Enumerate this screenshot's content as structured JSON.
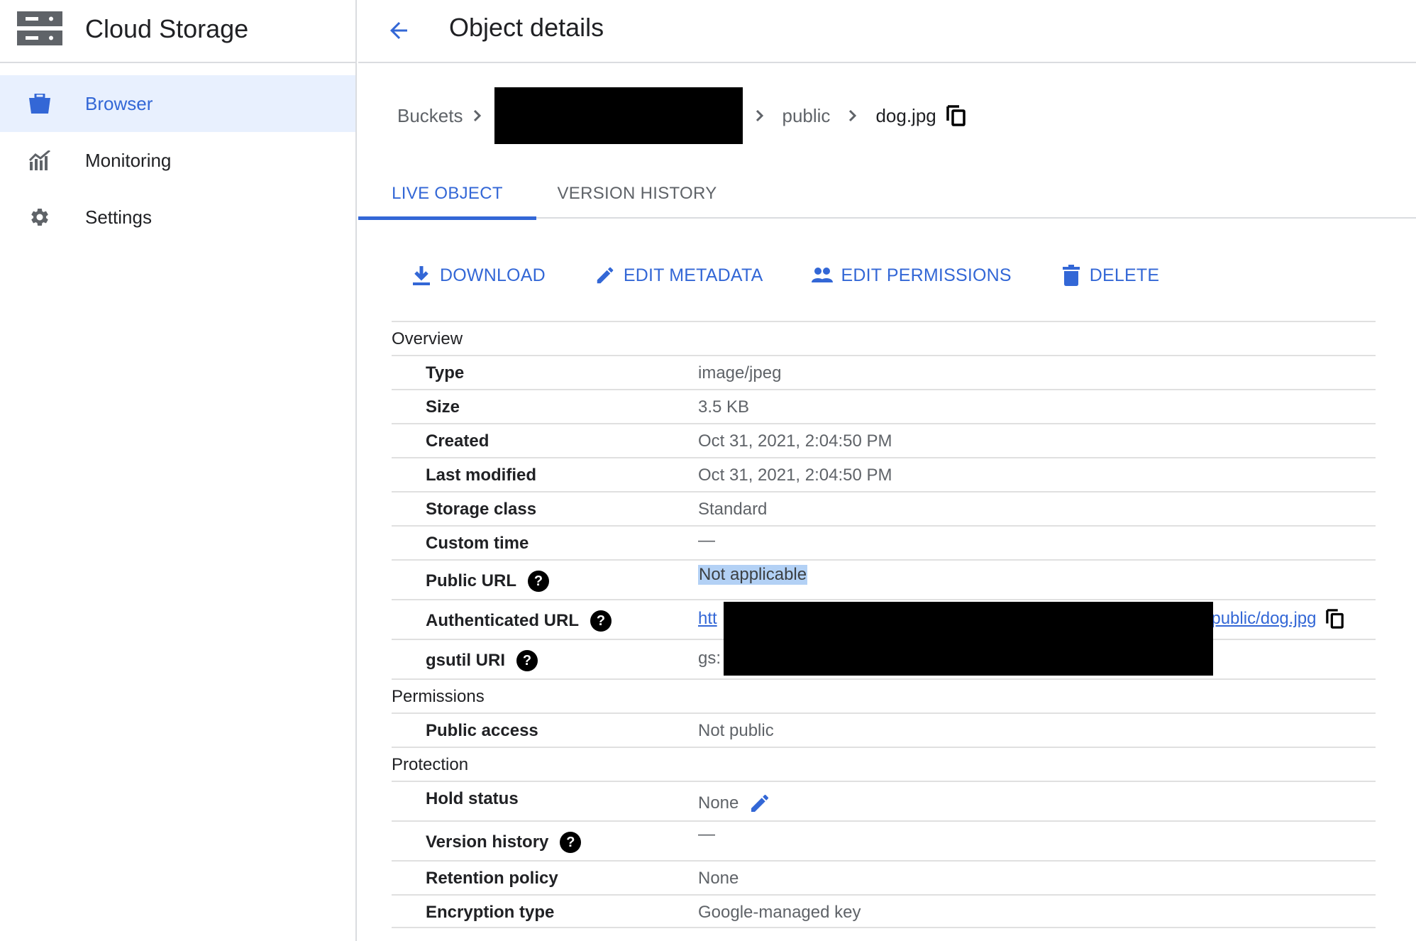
{
  "sidebar": {
    "title": "Cloud Storage",
    "items": [
      {
        "label": "Browser",
        "icon": "bucket-icon",
        "active": true
      },
      {
        "label": "Monitoring",
        "icon": "monitoring-chart-icon",
        "active": false
      },
      {
        "label": "Settings",
        "icon": "gear-icon",
        "active": false
      }
    ]
  },
  "header": {
    "title": "Object details",
    "back_icon": "arrow-left-icon"
  },
  "breadcrumb": {
    "items": [
      "Buckets",
      "public"
    ],
    "bucket_redacted": true,
    "current": "dog.jpg"
  },
  "tabs": [
    {
      "label": "LIVE OBJECT",
      "active": true
    },
    {
      "label": "VERSION HISTORY",
      "active": false
    }
  ],
  "actions": {
    "download": "DOWNLOAD",
    "edit_metadata": "EDIT METADATA",
    "edit_permissions": "EDIT PERMISSIONS",
    "delete": "DELETE"
  },
  "details": {
    "overview": {
      "heading": "Overview",
      "type": {
        "label": "Type",
        "value": "image/jpeg"
      },
      "size": {
        "label": "Size",
        "value": "3.5 KB"
      },
      "created": {
        "label": "Created",
        "value": "Oct 31, 2021, 2:04:50 PM"
      },
      "last_modified": {
        "label": "Last modified",
        "value": "Oct 31, 2021, 2:04:50 PM"
      },
      "storage_class": {
        "label": "Storage class",
        "value": "Standard"
      },
      "custom_time": {
        "label": "Custom time",
        "value": "—"
      },
      "public_url": {
        "label": "Public URL",
        "value": "Not applicable"
      },
      "authenticated_url": {
        "label": "Authenticated URL",
        "value_prefix": "htt",
        "value_suffix": "/public/dog.jpg"
      },
      "gsutil_uri": {
        "label": "gsutil URI",
        "value_prefix": "gs:"
      }
    },
    "permissions": {
      "heading": "Permissions",
      "public_access": {
        "label": "Public access",
        "value": "Not public"
      }
    },
    "protection": {
      "heading": "Protection",
      "hold_status": {
        "label": "Hold status",
        "value": "None"
      },
      "version_history": {
        "label": "Version history",
        "value": "—"
      },
      "retention_policy": {
        "label": "Retention policy",
        "value": "None"
      },
      "encryption_type": {
        "label": "Encryption type",
        "value": "Google-managed key"
      }
    }
  },
  "help_glyph": "?",
  "colors": {
    "accent": "#3367d6",
    "active_bg": "#e8f0fe",
    "selection": "#b3d1f5"
  }
}
